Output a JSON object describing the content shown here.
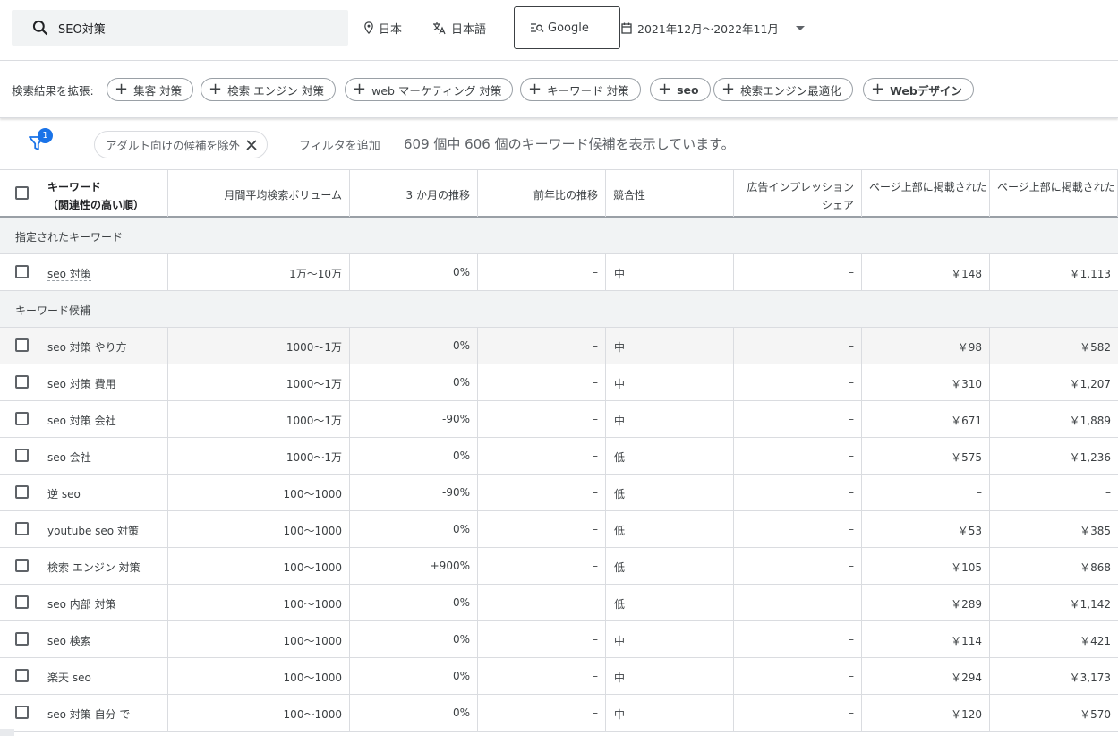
{
  "topbar": {
    "search_query": "SEO対策",
    "location": "日本",
    "language": "日本語",
    "engine": "Google",
    "date_range": "2021年12月～2022年11月"
  },
  "expand": {
    "label": "検索結果を拡張:",
    "chips": [
      {
        "text": "集客 対策"
      },
      {
        "text": "検索 エンジン 対策"
      },
      {
        "text": "web マーケティング 対策"
      },
      {
        "text": "キーワード 対策"
      },
      {
        "text": "seo"
      },
      {
        "text": "検索エンジン最適化"
      },
      {
        "text": "Webデザイン"
      }
    ]
  },
  "filters": {
    "badge_count": "1",
    "active_filter": "アダルト向けの候補を除外",
    "add_filter": "フィルタを追加",
    "summary": "609 個中 606 個のキーワード候補を表示しています。"
  },
  "table": {
    "headers": {
      "keyword_line1": "キーワード",
      "keyword_line2": "（関連性の高い順）",
      "volume": "月間平均検索ボリューム",
      "three_month": "3 か月の推移",
      "yoy": "前年比の推移",
      "competition": "競合性",
      "impression_share_line1": "広告インプレッション",
      "impression_share_line2": "シェア",
      "top_bid_low": "ページ上部に掲載された",
      "top_bid_high": "ページ上部に掲載された"
    },
    "section_specified": "指定されたキーワード",
    "specified_rows": [
      {
        "keyword": "seo 対策",
        "volume": "1万～10万",
        "three_month": "0%",
        "yoy": "–",
        "competition": "中",
        "share": "–",
        "bid_low": "￥148",
        "bid_high": "￥1,113"
      }
    ],
    "section_ideas": "キーワード候補",
    "idea_rows": [
      {
        "keyword": "seo 対策 やり方",
        "volume": "1000～1万",
        "three_month": "0%",
        "yoy": "–",
        "competition": "中",
        "share": "–",
        "bid_low": "￥98",
        "bid_high": "￥582"
      },
      {
        "keyword": "seo 対策 費用",
        "volume": "1000～1万",
        "three_month": "0%",
        "yoy": "–",
        "competition": "中",
        "share": "–",
        "bid_low": "￥310",
        "bid_high": "￥1,207"
      },
      {
        "keyword": "seo 対策 会社",
        "volume": "1000～1万",
        "three_month": "-90%",
        "yoy": "–",
        "competition": "中",
        "share": "–",
        "bid_low": "￥671",
        "bid_high": "￥1,889"
      },
      {
        "keyword": "seo 会社",
        "volume": "1000～1万",
        "three_month": "0%",
        "yoy": "–",
        "competition": "低",
        "share": "–",
        "bid_low": "￥575",
        "bid_high": "￥1,236"
      },
      {
        "keyword": "逆 seo",
        "volume": "100～1000",
        "three_month": "-90%",
        "yoy": "–",
        "competition": "低",
        "share": "–",
        "bid_low": "–",
        "bid_high": "–"
      },
      {
        "keyword": "youtube seo 対策",
        "volume": "100～1000",
        "three_month": "0%",
        "yoy": "–",
        "competition": "低",
        "share": "–",
        "bid_low": "￥53",
        "bid_high": "￥385"
      },
      {
        "keyword": "検索 エンジン 対策",
        "volume": "100～1000",
        "three_month": "+900%",
        "yoy": "–",
        "competition": "低",
        "share": "–",
        "bid_low": "￥105",
        "bid_high": "￥868"
      },
      {
        "keyword": "seo 内部 対策",
        "volume": "100～1000",
        "three_month": "0%",
        "yoy": "–",
        "competition": "低",
        "share": "–",
        "bid_low": "￥289",
        "bid_high": "￥1,142"
      },
      {
        "keyword": "seo 検索",
        "volume": "100～1000",
        "three_month": "0%",
        "yoy": "–",
        "competition": "中",
        "share": "–",
        "bid_low": "￥114",
        "bid_high": "￥421"
      },
      {
        "keyword": "楽天 seo",
        "volume": "100～1000",
        "three_month": "0%",
        "yoy": "–",
        "competition": "中",
        "share": "–",
        "bid_low": "￥294",
        "bid_high": "￥3,173"
      },
      {
        "keyword": "seo 対策 自分 で",
        "volume": "100～1000",
        "three_month": "0%",
        "yoy": "–",
        "competition": "中",
        "share": "–",
        "bid_low": "￥120",
        "bid_high": "￥570"
      }
    ]
  },
  "colors": {
    "accent": "#1a73e8",
    "border": "#dadce0",
    "section_bg": "#f1f3f4",
    "text": "#3c4043"
  }
}
